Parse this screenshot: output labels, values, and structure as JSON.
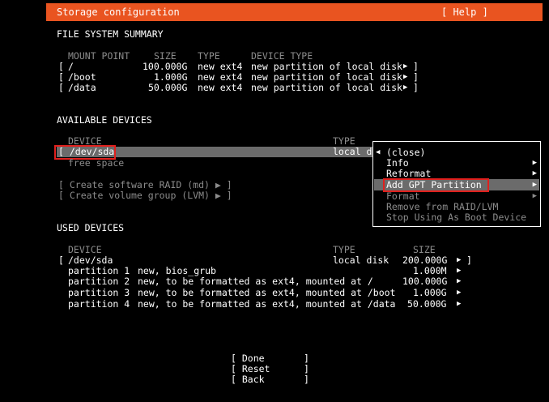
{
  "header": {
    "title": "Storage configuration",
    "help": "[ Help ]"
  },
  "fs_summary": {
    "section_title": "FILE SYSTEM SUMMARY",
    "columns": [
      "MOUNT POINT",
      "SIZE",
      "TYPE",
      "DEVICE TYPE"
    ],
    "rows": [
      {
        "bracket": "[",
        "mount": "/",
        "size": "100.000G",
        "type": "new ext4",
        "device_type": "new partition of local disk",
        "arrow": "▶",
        "close": "]"
      },
      {
        "bracket": "[",
        "mount": "/boot",
        "size": "1.000G",
        "type": "new ext4",
        "device_type": "new partition of local disk",
        "arrow": "▶",
        "close": "]"
      },
      {
        "bracket": "[",
        "mount": "/data",
        "size": "50.000G",
        "type": "new ext4",
        "device_type": "new partition of local disk",
        "arrow": "▶",
        "close": "]"
      }
    ]
  },
  "available": {
    "section_title": "AVAILABLE DEVICES",
    "col_device": "DEVICE",
    "col_type": "TYPE",
    "device": "[ /dev/sda",
    "device_type": "local d",
    "free_space": "free space",
    "create_raid": "[ Create software RAID (md) ▶ ]",
    "create_lvm": "[ Create volume group (LVM) ▶ ]"
  },
  "popup": {
    "items": [
      {
        "label": "(close)",
        "prefix": "◀",
        "arrow": "",
        "enabled": true
      },
      {
        "label": "Info",
        "arrow": "▶",
        "enabled": true
      },
      {
        "label": "Reformat",
        "arrow": "▶",
        "enabled": true
      },
      {
        "label": "Add GPT Partition",
        "arrow": "▶",
        "enabled": true,
        "selected": true
      },
      {
        "label": "Format",
        "arrow": "▶",
        "enabled": false
      },
      {
        "label": "Remove from RAID/LVM",
        "arrow": "",
        "enabled": false
      },
      {
        "label": "Stop Using As Boot Device",
        "arrow": "",
        "enabled": false
      }
    ]
  },
  "used": {
    "section_title": "USED DEVICES",
    "col_device": "DEVICE",
    "col_type": "TYPE",
    "col_size": "SIZE",
    "disk": {
      "bracket": "[",
      "name": "/dev/sda",
      "type": "local disk",
      "size": "200.000G",
      "arrow": "▶",
      "close": "]"
    },
    "partitions": [
      {
        "name": "partition 1",
        "desc": "new, bios_grub",
        "size": "1.000M",
        "arrow": "▶"
      },
      {
        "name": "partition 2",
        "desc": "new, to be formatted as ext4, mounted at /",
        "size": "100.000G",
        "arrow": "▶"
      },
      {
        "name": "partition 3",
        "desc": "new, to be formatted as ext4, mounted at /boot",
        "size": "1.000G",
        "arrow": "▶"
      },
      {
        "name": "partition 4",
        "desc": "new, to be formatted as ext4, mounted at /data",
        "size": "50.000G",
        "arrow": "▶"
      }
    ]
  },
  "buttons": {
    "done": "[ Done       ]",
    "reset": "[ Reset      ]",
    "back": "[ Back       ]"
  },
  "colors": {
    "accent": "#e95420",
    "selection": "#6b6b6b",
    "highlight_box": "#e0201d"
  }
}
